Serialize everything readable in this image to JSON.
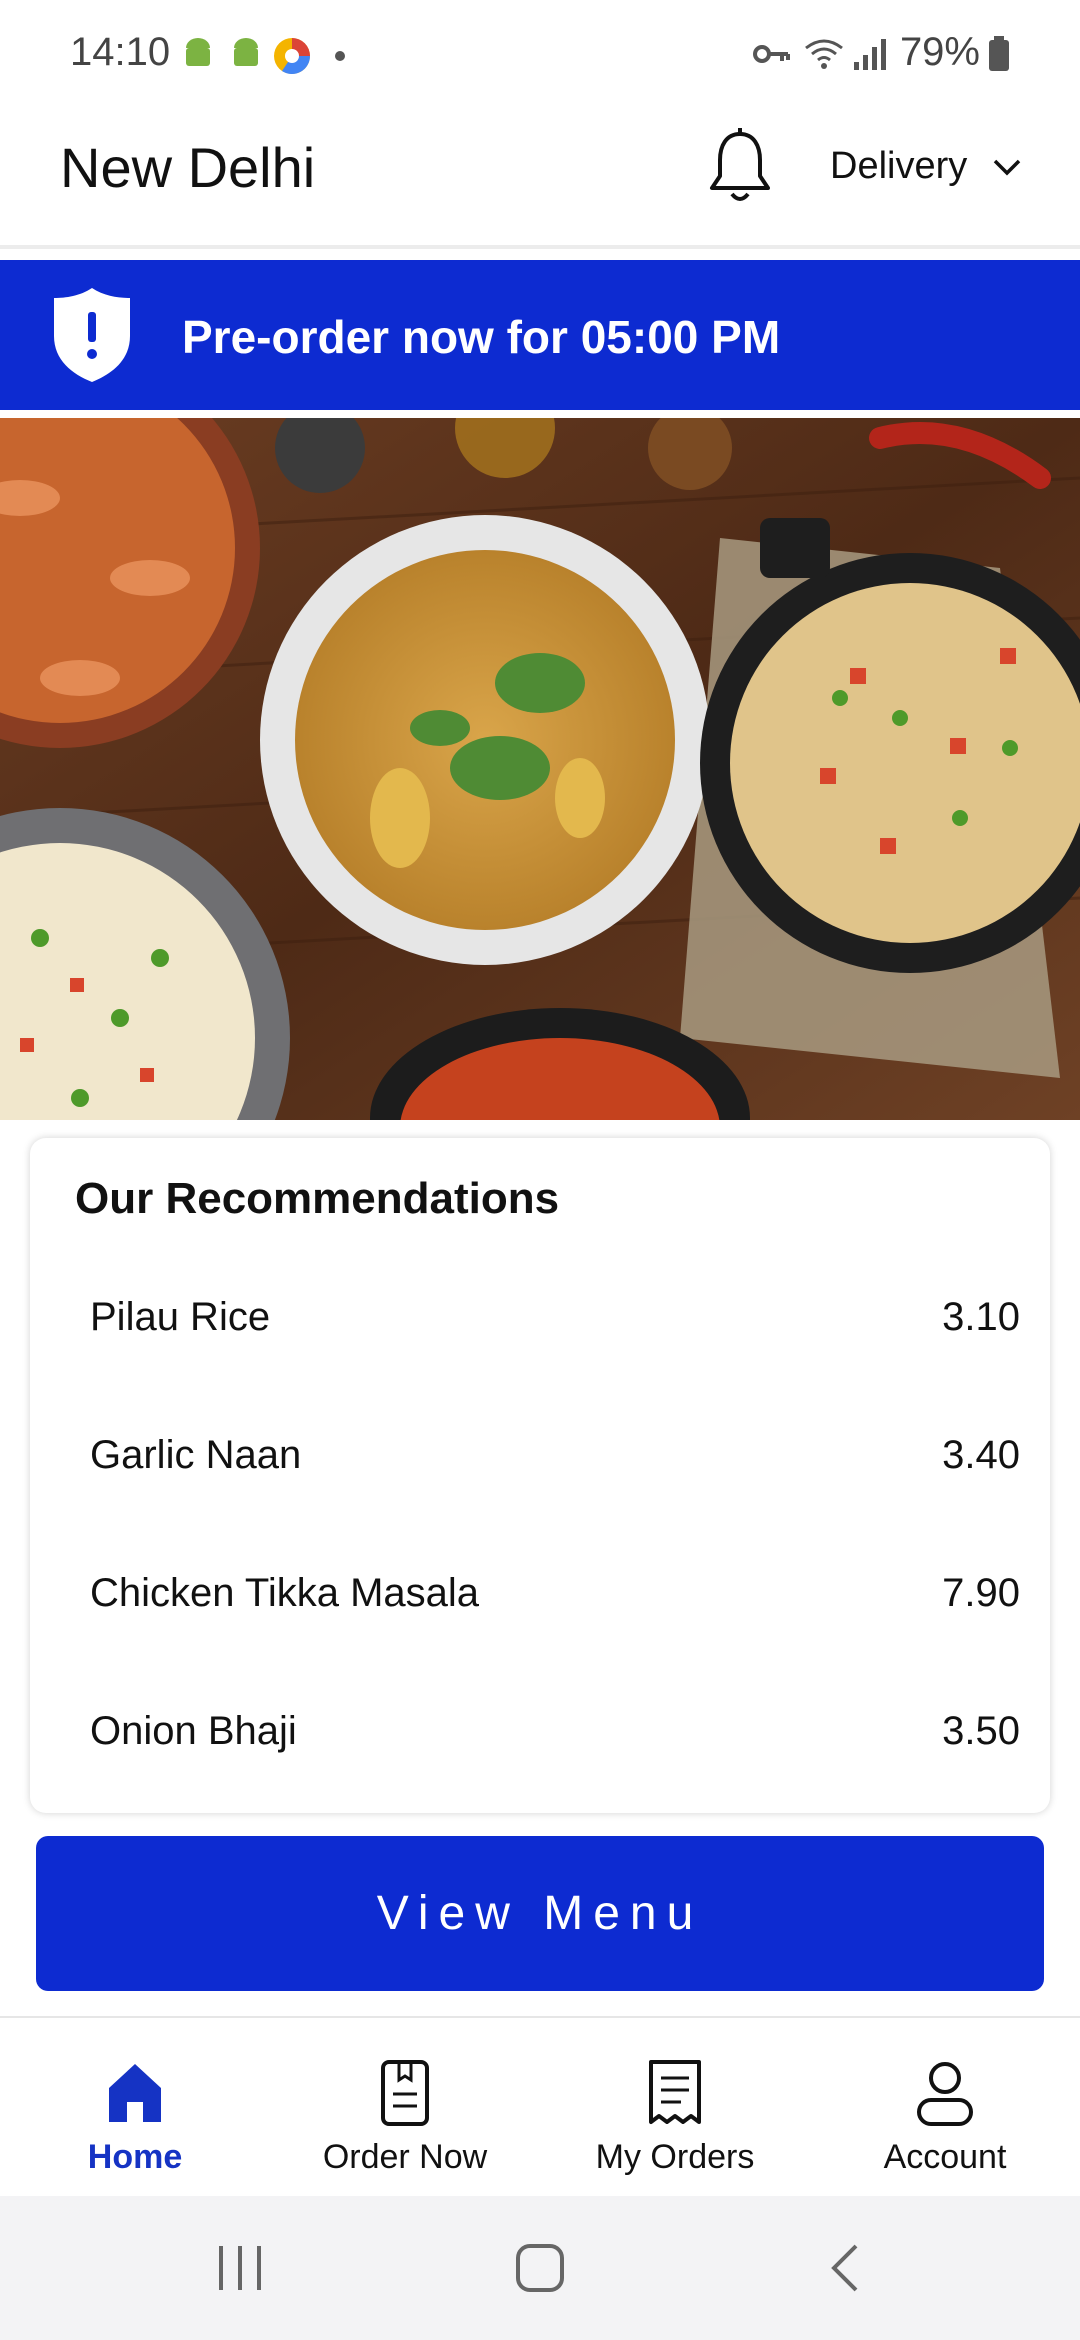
{
  "status_bar": {
    "time": "14:10",
    "battery": "79%",
    "icons": [
      "android-icon",
      "android-icon",
      "chrome-icon",
      "dot-icon",
      "key-icon",
      "wifi-icon",
      "signal-icon",
      "battery-icon"
    ]
  },
  "header": {
    "city": "New Delhi",
    "bell_icon": "bell-icon",
    "delivery_mode": "Delivery",
    "chevron_icon": "chevron-down-icon"
  },
  "banner": {
    "text": "Pre-order now for 05:00 PM",
    "icon": "shield-alert-icon",
    "color": "#0d2bd1"
  },
  "recommendations": {
    "title": "Our Recommendations",
    "items": [
      {
        "name": "Pilau Rice",
        "price": "3.10"
      },
      {
        "name": "Garlic Naan",
        "price": "3.40"
      },
      {
        "name": "Chicken Tikka Masala",
        "price": "7.90"
      },
      {
        "name": "Onion Bhaji",
        "price": "3.50"
      }
    ]
  },
  "cta": {
    "label": "View Menu",
    "color": "#0d2bd1"
  },
  "bottom_nav": {
    "items": [
      {
        "label": "Home",
        "icon": "home-icon",
        "active": true
      },
      {
        "label": "Order Now",
        "icon": "order-icon",
        "active": false
      },
      {
        "label": "My Orders",
        "icon": "receipt-icon",
        "active": false
      },
      {
        "label": "Account",
        "icon": "account-icon",
        "active": false
      }
    ],
    "active_color": "#1533c4"
  },
  "system_nav": {
    "icons": [
      "recents-icon",
      "home-square-icon",
      "back-icon"
    ]
  }
}
